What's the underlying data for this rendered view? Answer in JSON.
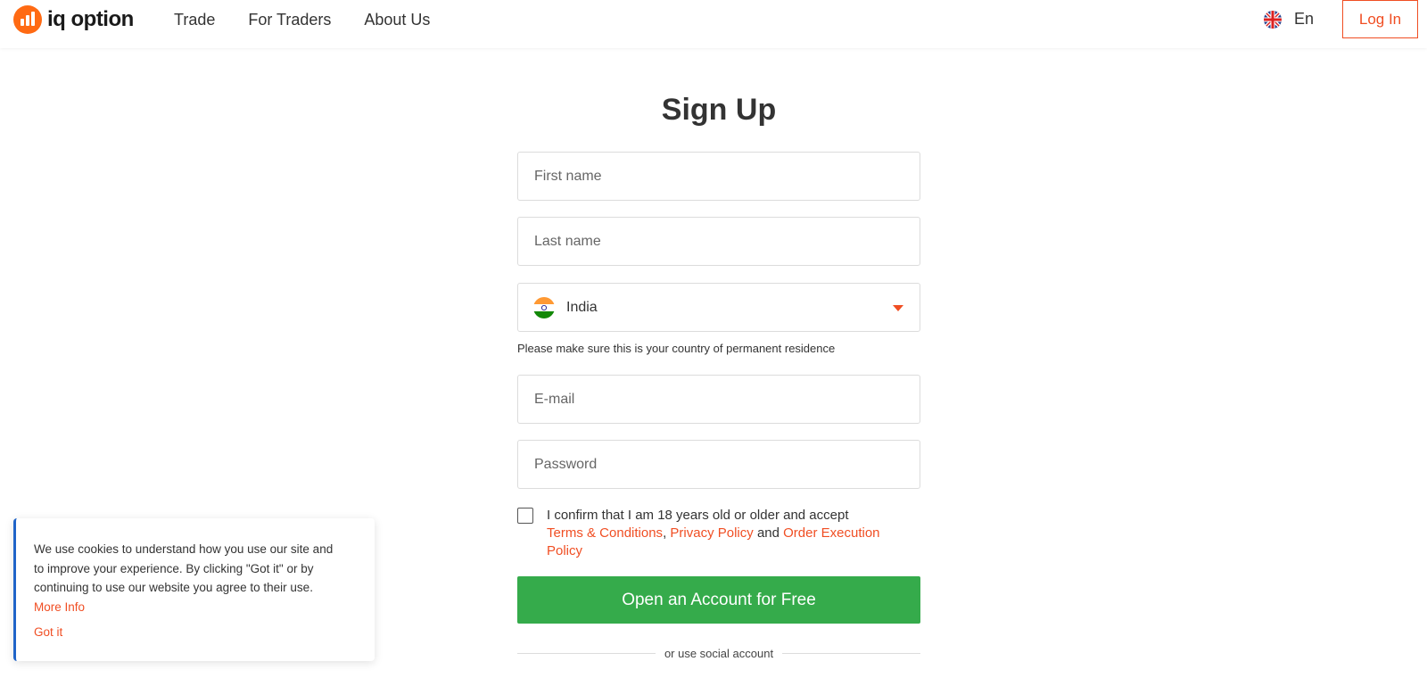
{
  "header": {
    "logo_text": "iq option",
    "nav": [
      "Trade",
      "For Traders",
      "About Us"
    ],
    "language": "En",
    "login_label": "Log In"
  },
  "form": {
    "title": "Sign Up",
    "first_name_placeholder": "First name",
    "last_name_placeholder": "Last name",
    "country": "India",
    "country_hint": "Please make sure this is your country of permanent residence",
    "email_placeholder": "E-mail",
    "password_placeholder": "Password",
    "consent_prefix": "I confirm that I am 18 years old or older and accept",
    "terms_link": "Terms & Conditions",
    "comma": ",",
    "privacy_link": "Privacy Policy",
    "and_text": "and",
    "order_link": "Order Execution Policy",
    "submit_label": "Open an Account for Free",
    "social_divider": "or use social account"
  },
  "cookie": {
    "text": "We use cookies to understand how you use our site and to improve your experience. By clicking \"Got it\" or by continuing to use our website you agree to their use.",
    "more_info": "More Info",
    "got_it": "Got it"
  },
  "colors": {
    "brand_orange": "#ff6a13",
    "accent_red": "#f04e23",
    "cta_green": "#35ab4b",
    "cookie_border": "#1f64c8"
  }
}
